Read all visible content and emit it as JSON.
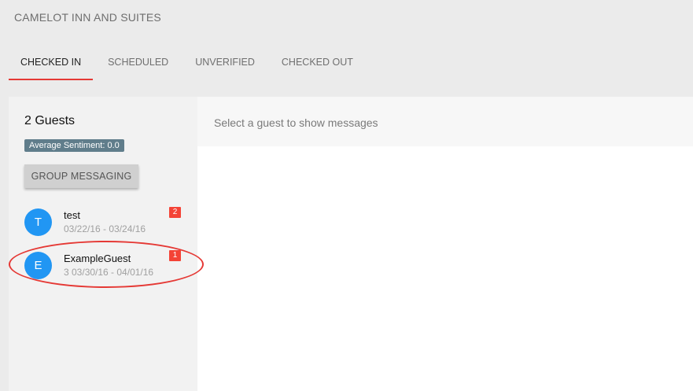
{
  "header": {
    "hotel_name": "CAMELOT INN AND SUITES"
  },
  "tabs": [
    {
      "label": "CHECKED IN",
      "active": true
    },
    {
      "label": "SCHEDULED",
      "active": false
    },
    {
      "label": "UNVERIFIED",
      "active": false
    },
    {
      "label": "CHECKED OUT",
      "active": false
    }
  ],
  "sidebar": {
    "guest_count": "2 Guests",
    "sentiment": "Average Sentiment: 0.0",
    "group_messaging_label": "GROUP MESSAGING",
    "guests": [
      {
        "initial": "T",
        "name": "test",
        "dates": "03/22/16 - 03/24/16",
        "unread": "2"
      },
      {
        "initial": "E",
        "name": "ExampleGuest",
        "dates": "3 03/30/16 - 04/01/16",
        "unread": "1",
        "highlighted": true
      }
    ]
  },
  "main": {
    "empty_message": "Select a guest to show messages"
  },
  "colors": {
    "accent": "#e53935",
    "avatar": "#2196f3",
    "badge": "#f44336",
    "sentiment_badge": "#607d8b"
  }
}
